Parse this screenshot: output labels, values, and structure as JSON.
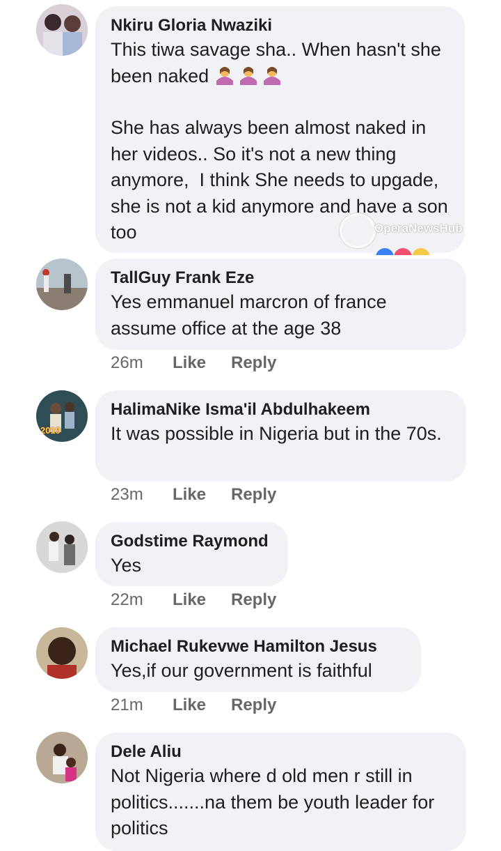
{
  "comments": [
    {
      "author": "Nkiru Gloria Nwaziki",
      "text": "This tiwa savage sha.. When hasn't she been naked",
      "text2": "She has always been almost naked in her videos.. So it's not a new thing anymore,  I think She needs to upgade,  she is not a kid anymore and have a son too",
      "emoji": "woman-shrugging-icon"
    },
    {
      "author": "TallGuy Frank Eze",
      "text": "Yes emmanuel marcron of france assume office at the age 38",
      "time": "26m",
      "like": "Like",
      "reply": "Reply"
    },
    {
      "author": "HalimaNike Isma'il Abdulhakeem",
      "text": "It was possible in Nigeria but in the 70s.",
      "time": "23m",
      "like": "Like",
      "reply": "Reply",
      "avatar_badge": "2019"
    },
    {
      "author": "Godstime Raymond",
      "text": "Yes",
      "time": "22m",
      "like": "Like",
      "reply": "Reply"
    },
    {
      "author": "Michael Rukevwe Hamilton Jesus",
      "text": "Yes,if our government is faithful",
      "time": "21m",
      "like": "Like",
      "reply": "Reply"
    },
    {
      "author": "Dele Aliu",
      "text": "Not Nigeria where d old men r still in politics.......na them be youth leader for politics"
    }
  ],
  "watermark": "OperaNewsHub",
  "colors": {
    "bubble": "#f0f2f5",
    "meta": "#65676b",
    "text": "#1c1e21"
  }
}
